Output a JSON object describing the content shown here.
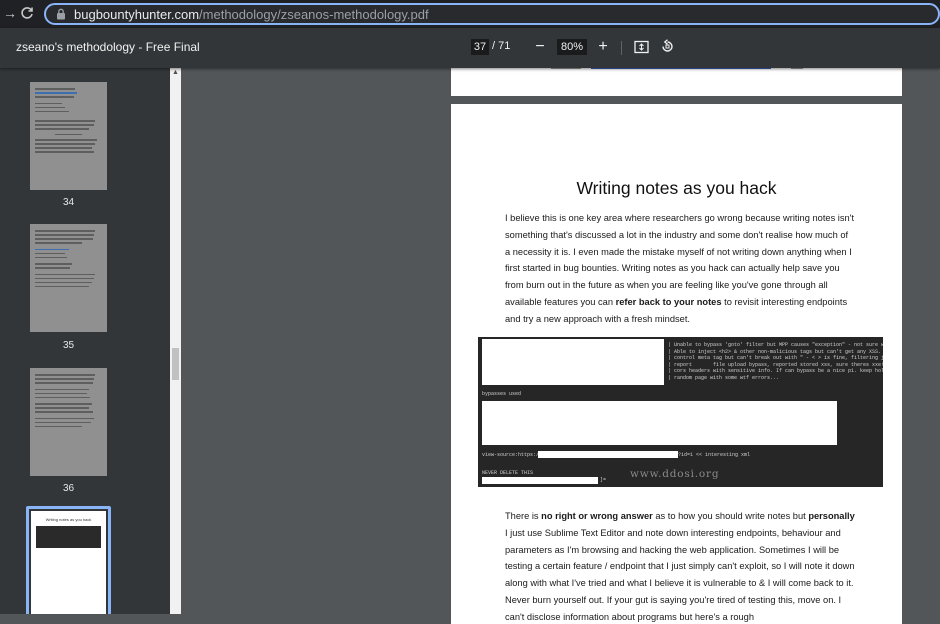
{
  "browser": {
    "url_host": "bugbountyhunter.com",
    "url_path": "/methodology/zseanos-methodology.pdf",
    "back_icon": "back-arrow-icon",
    "reload_icon": "reload-icon"
  },
  "toolbar": {
    "title": "zseano's methodology - Free Final",
    "current_page": "37",
    "total_pages": "/ 71",
    "zoom_out": "−",
    "zoom_level": "80%",
    "zoom_in": "+",
    "fit_icon": "fit-to-page-icon",
    "rotate_icon": "rotate-icon"
  },
  "sidebar": {
    "thumbnails": [
      {
        "label": "34"
      },
      {
        "label": "35"
      },
      {
        "label": "36"
      }
    ],
    "selected_thumb_title": "Writing notes as you hack"
  },
  "page": {
    "heading": "Writing notes as you hack",
    "para1_a": "I believe this is one key area where researchers go wrong because writing notes isn't something that's discussed a lot in the industry and some don't realise how much of a necessity it is. I even made the mistake myself of not writing down anything when I first started in bug bounties. Writing notes as you hack can actually help save you from burn out in the future as when you are feeling like you've gone through all available features you can ",
    "para1_bold": "refer back to your notes",
    "para1_b": " to revisit interesting endpoints and try a new approach with a fresh mindset.",
    "para2_a": "There is ",
    "para2_bold1": "no right or wrong answer",
    "para2_b": " as to how you should write notes but ",
    "para2_bold2": "personally",
    "para2_c": " I just use Sublime Text Editor and note down interesting endpoints, behaviour and parameters as I'm browsing and hacking the web application. Sometimes I will be testing a certain feature / endpoint that I just simply can't exploit, so I will note it down along with what I've tried and what I believe it is vulnerable to & I will come back to it. Never burn yourself out. If your gut is saying you're tired of testing this, move on. I can't disclose information about programs but here's a rough",
    "code": {
      "notes": "| Unable to bypass 'goto' filter but MPP causes \"exception\" - not sure why\n| Able to inject <h2> & other non-malicious tags but can't get any XSS.\n| control meta tag but can't break out with \" - < > is fine, filtering just on \"\n| report       file upload bypass, reported stored xss, sure theres xxe!\n| cors headers with sensitive info. If can bypass be a nice p1. keep hold of\n| random page with some wtf errors...",
      "bypasses": "bypasses used",
      "view_source_a": "view-source:https://",
      "view_source_b": "?id=1 << interesting xml",
      "never_delete": "NEVER DELETE THIS",
      "tail": "]=",
      "watermark": "www.ddosi.org"
    }
  },
  "colors": {
    "accent": "#8ab4f8",
    "toolbar_bg": "#323639",
    "viewer_bg": "#525659"
  }
}
